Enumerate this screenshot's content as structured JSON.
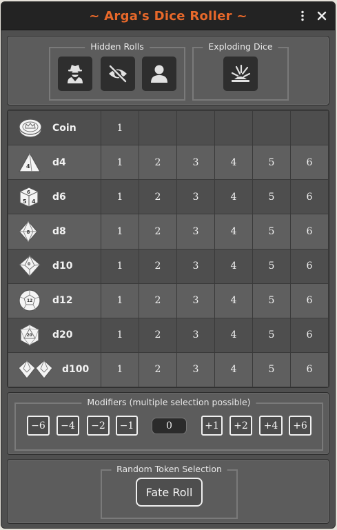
{
  "window": {
    "title": "~ Arga's Dice Roller ~"
  },
  "titlebar": {
    "menu_icon": "vertical-dots-icon",
    "close_icon": "close-icon"
  },
  "options": {
    "hidden_rolls": {
      "legend": "Hidden Rolls",
      "buttons": [
        {
          "icon": "spy-icon"
        },
        {
          "icon": "eye-slash-icon"
        },
        {
          "icon": "user-icon"
        }
      ]
    },
    "exploding_dice": {
      "legend": "Exploding Dice",
      "icon": "explosion-icon"
    }
  },
  "dice": [
    {
      "label": "Coin",
      "icon": "coin-icon",
      "counts": [
        "1"
      ]
    },
    {
      "label": "d4",
      "icon": "d4-icon",
      "counts": [
        "1",
        "2",
        "3",
        "4",
        "5",
        "6"
      ]
    },
    {
      "label": "d6",
      "icon": "d6-icon",
      "counts": [
        "1",
        "2",
        "3",
        "4",
        "5",
        "6"
      ]
    },
    {
      "label": "d8",
      "icon": "d8-icon",
      "counts": [
        "1",
        "2",
        "3",
        "4",
        "5",
        "6"
      ]
    },
    {
      "label": "d10",
      "icon": "d10-icon",
      "counts": [
        "1",
        "2",
        "3",
        "4",
        "5",
        "6"
      ]
    },
    {
      "label": "d12",
      "icon": "d12-icon",
      "counts": [
        "1",
        "2",
        "3",
        "4",
        "5",
        "6"
      ]
    },
    {
      "label": "d20",
      "icon": "d20-icon",
      "counts": [
        "1",
        "2",
        "3",
        "4",
        "5",
        "6"
      ]
    },
    {
      "label": "d100",
      "icon": "d100-icon",
      "counts": [
        "1",
        "2",
        "3",
        "4",
        "5",
        "6"
      ]
    }
  ],
  "modifiers": {
    "legend": "Modifiers (multiple selection possible)",
    "negative": [
      "−6",
      "−4",
      "−2",
      "−1"
    ],
    "current_value": "0",
    "positive": [
      "+1",
      "+2",
      "+4",
      "+6"
    ]
  },
  "token": {
    "legend": "Random Token Selection",
    "fate_label": "Fate Roll"
  },
  "colors": {
    "title": "#e8682a",
    "titlebar": "#232323",
    "panel": "#5c5c5c",
    "button_dark": "#2e2e2e"
  }
}
